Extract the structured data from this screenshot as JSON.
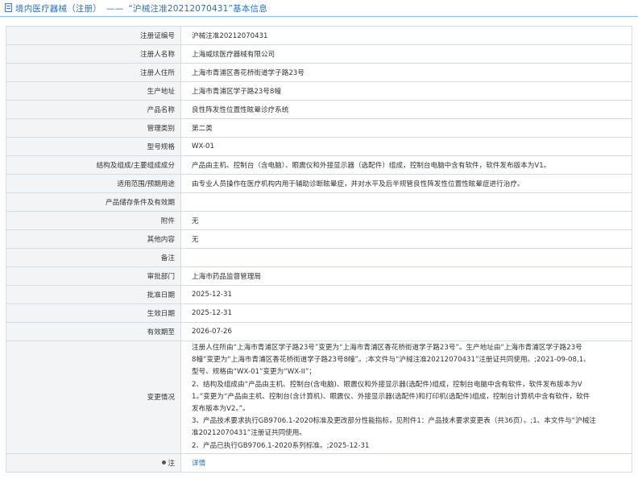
{
  "header": {
    "category": "境内医疗器械（注册）",
    "separator": "——",
    "record_title": "“沪械注准20212070431”基本信息"
  },
  "rows": [
    {
      "label": "注册证编号",
      "value": "沪械注准20212070431"
    },
    {
      "label": "注册人名称",
      "value": "上海威炫医疗器械有限公司"
    },
    {
      "label": "注册人住所",
      "value": "上海市青浦区香花桥街道学子路23号"
    },
    {
      "label": "生产地址",
      "value": "上海市青浦区学子路23号8幢"
    },
    {
      "label": "产品名称",
      "value": "良性阵发性位置性眩晕诊疗系统"
    },
    {
      "label": "管理类别",
      "value": "第二类"
    },
    {
      "label": "型号规格",
      "value": "WX-01"
    },
    {
      "label": "结构及组成/主要组成成分",
      "value": "产品由主机、控制台（含电脑）、眼震仪和外接显示器（选配件）组成，控制台电脑中含有软件，软件发布版本为V1。"
    },
    {
      "label": "适用范围/预期用途",
      "value": "由专业人员操作在医疗机构内用于辅助诊断眩晕症，并对水平及后半规管良性阵发性位置性眩晕症进行治疗。"
    },
    {
      "label": "产品储存条件及有效期",
      "value": ""
    },
    {
      "label": "附件",
      "value": "无"
    },
    {
      "label": "其他内容",
      "value": "无"
    },
    {
      "label": "备注",
      "value": ""
    },
    {
      "label": "审批部门",
      "value": "上海市药品监督管理局"
    },
    {
      "label": "批准日期",
      "value": "2025-12-31"
    },
    {
      "label": "生效日期",
      "value": "2025-12-31"
    },
    {
      "label": "有效期至",
      "value": "2026-07-26"
    }
  ],
  "change": {
    "label": "变更情况",
    "lines": [
      "注册人住所由“上海市青浦区学子路23号”变更为“上海市青浦区香花桥街道学子路23号”。生产地址由“上海市青浦区学子路23号",
      "8幢”变更为“上海市青浦区香花桥街道学子路23号8幢”。;本文件与“沪械注准20212070431”注册证共同使用。;2021-09-08,1、",
      "型号、规格由“WX-01”变更为“WX-II”；",
      "2、结构及组成由“产品由主机、控制台(含电脑)、眼震仪和外接显示器(选配件)组成，控制台电脑中含有软件，软件发布版本为V",
      "1。”变更为“产品由主机、控制台(含计算机)、眼震仪、外接显示器(选配件)和打印机(选配件)组成，控制台计算机中含有软件，软件",
      "发布版本为V2。”。",
      "3、产品技术要求执行GB9706.1-2020标准及更改部分性能指标，见附件1：产品技术要求变更表（共36页）。;1、本文件与“沪械注",
      "准20212070431”注册证共同使用。",
      "2、产品已执行GB9706.1-2020系列标准。;2025-12-31"
    ]
  },
  "note": {
    "label": "注",
    "link_text": "详情"
  }
}
